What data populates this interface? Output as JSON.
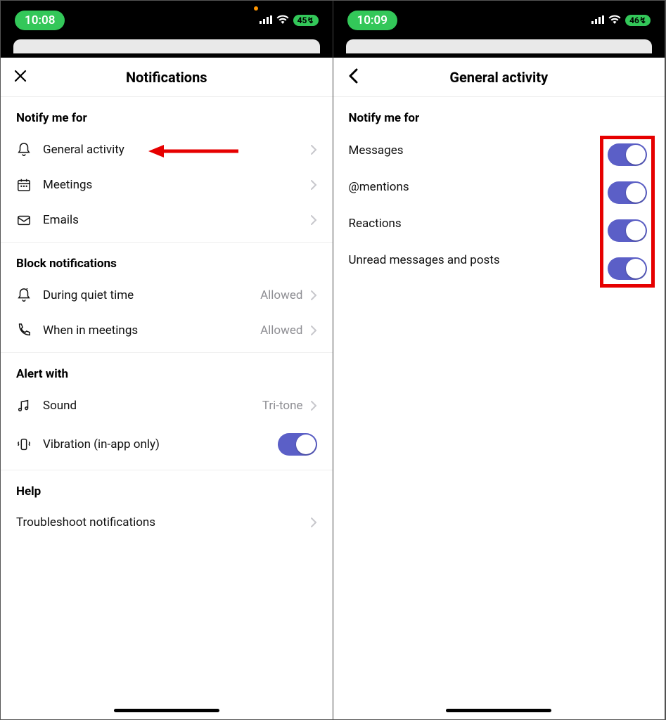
{
  "left": {
    "status": {
      "time": "10:08",
      "battery": "45"
    },
    "header": {
      "title": "Notifications"
    },
    "sections": {
      "notify": {
        "title": "Notify me for",
        "items": [
          {
            "label": "General activity"
          },
          {
            "label": "Meetings"
          },
          {
            "label": "Emails"
          }
        ]
      },
      "block": {
        "title": "Block notifications",
        "items": [
          {
            "label": "During quiet time",
            "value": "Allowed"
          },
          {
            "label": "When in meetings",
            "value": "Allowed"
          }
        ]
      },
      "alert": {
        "title": "Alert with",
        "sound": {
          "label": "Sound",
          "value": "Tri-tone"
        },
        "vibration": {
          "label": "Vibration (in-app only)"
        }
      },
      "help": {
        "title": "Help",
        "item": {
          "label": "Troubleshoot notifications"
        }
      }
    }
  },
  "right": {
    "status": {
      "time": "10:09",
      "battery": "46"
    },
    "header": {
      "title": "General activity"
    },
    "section_title": "Notify me for",
    "items": [
      {
        "label": "Messages",
        "on": true
      },
      {
        "label": "@mentions",
        "on": true
      },
      {
        "label": "Reactions",
        "on": true
      },
      {
        "label": "Unread messages and posts",
        "on": true
      }
    ]
  }
}
